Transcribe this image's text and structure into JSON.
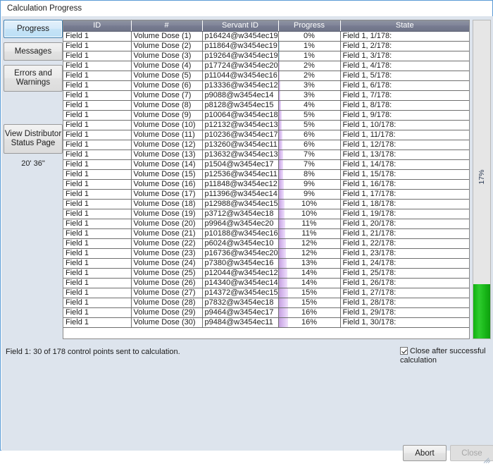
{
  "window": {
    "title": "Calculation Progress"
  },
  "nav": {
    "buttons": [
      {
        "id": "progress",
        "label": "Progress",
        "selected": true
      },
      {
        "id": "messages",
        "label": "Messages",
        "selected": false
      },
      {
        "id": "errors",
        "label": "Errors and Warnings",
        "selected": false
      },
      {
        "id": "view-distributor",
        "label": "View Distributor Status Page",
        "selected": false
      }
    ],
    "elapsed_time": "20' 36\""
  },
  "grid": {
    "columns": [
      "ID",
      "#",
      "Servant ID",
      "Progress",
      "State"
    ],
    "rows": [
      {
        "id": "Field 1",
        "num": "Volume Dose (1)",
        "servant": "p16424@w3454ec19",
        "progress": "0%",
        "pct": 0,
        "state": "Field 1, 1/178:"
      },
      {
        "id": "Field 1",
        "num": "Volume Dose (2)",
        "servant": "p11864@w3454ec19",
        "progress": "1%",
        "pct": 1,
        "state": "Field 1, 2/178:"
      },
      {
        "id": "Field 1",
        "num": "Volume Dose (3)",
        "servant": "p19264@w3454ec19",
        "progress": "1%",
        "pct": 1,
        "state": "Field 1, 3/178:"
      },
      {
        "id": "Field 1",
        "num": "Volume Dose (4)",
        "servant": "p17724@w3454ec20",
        "progress": "2%",
        "pct": 2,
        "state": "Field 1, 4/178:"
      },
      {
        "id": "Field 1",
        "num": "Volume Dose (5)",
        "servant": "p11044@w3454ec16",
        "progress": "2%",
        "pct": 2,
        "state": "Field 1, 5/178:"
      },
      {
        "id": "Field 1",
        "num": "Volume Dose (6)",
        "servant": "p13336@w3454ec12",
        "progress": "3%",
        "pct": 3,
        "state": "Field 1, 6/178:"
      },
      {
        "id": "Field 1",
        "num": "Volume Dose (7)",
        "servant": "p9088@w3454ec14",
        "progress": "3%",
        "pct": 3,
        "state": "Field 1, 7/178:"
      },
      {
        "id": "Field 1",
        "num": "Volume Dose (8)",
        "servant": "p8128@w3454ec15",
        "progress": "4%",
        "pct": 4,
        "state": "Field 1, 8/178:"
      },
      {
        "id": "Field 1",
        "num": "Volume Dose (9)",
        "servant": "p10064@w3454ec18",
        "progress": "5%",
        "pct": 5,
        "state": "Field 1, 9/178:"
      },
      {
        "id": "Field 1",
        "num": "Volume Dose (10)",
        "servant": "p12132@w3454ec13",
        "progress": "5%",
        "pct": 5,
        "state": "Field 1, 10/178:"
      },
      {
        "id": "Field 1",
        "num": "Volume Dose (11)",
        "servant": "p10236@w3454ec17",
        "progress": "6%",
        "pct": 6,
        "state": "Field 1, 11/178:"
      },
      {
        "id": "Field 1",
        "num": "Volume Dose (12)",
        "servant": "p13260@w3454ec11",
        "progress": "6%",
        "pct": 6,
        "state": "Field 1, 12/178:"
      },
      {
        "id": "Field 1",
        "num": "Volume Dose (13)",
        "servant": "p13632@w3454ec13",
        "progress": "7%",
        "pct": 7,
        "state": "Field 1, 13/178:"
      },
      {
        "id": "Field 1",
        "num": "Volume Dose (14)",
        "servant": "p1504@w3454ec17",
        "progress": "7%",
        "pct": 7,
        "state": "Field 1, 14/178:"
      },
      {
        "id": "Field 1",
        "num": "Volume Dose (15)",
        "servant": "p12536@w3454ec11",
        "progress": "8%",
        "pct": 8,
        "state": "Field 1, 15/178:"
      },
      {
        "id": "Field 1",
        "num": "Volume Dose (16)",
        "servant": "p11848@w3454ec12",
        "progress": "9%",
        "pct": 9,
        "state": "Field 1, 16/178:"
      },
      {
        "id": "Field 1",
        "num": "Volume Dose (17)",
        "servant": "p11396@w3454ec14",
        "progress": "9%",
        "pct": 9,
        "state": "Field 1, 17/178:"
      },
      {
        "id": "Field 1",
        "num": "Volume Dose (18)",
        "servant": "p12988@w3454ec15",
        "progress": "10%",
        "pct": 10,
        "state": "Field 1, 18/178:"
      },
      {
        "id": "Field 1",
        "num": "Volume Dose (19)",
        "servant": "p3712@w3454ec18",
        "progress": "10%",
        "pct": 10,
        "state": "Field 1, 19/178:"
      },
      {
        "id": "Field 1",
        "num": "Volume Dose (20)",
        "servant": "p9964@w3454ec20",
        "progress": "11%",
        "pct": 11,
        "state": "Field 1, 20/178:"
      },
      {
        "id": "Field 1",
        "num": "Volume Dose (21)",
        "servant": "p10188@w3454ec16",
        "progress": "11%",
        "pct": 11,
        "state": "Field 1, 21/178:"
      },
      {
        "id": "Field 1",
        "num": "Volume Dose (22)",
        "servant": "p6024@w3454ec10",
        "progress": "12%",
        "pct": 12,
        "state": "Field 1, 22/178:"
      },
      {
        "id": "Field 1",
        "num": "Volume Dose (23)",
        "servant": "p16736@w3454ec20",
        "progress": "12%",
        "pct": 12,
        "state": "Field 1, 23/178:"
      },
      {
        "id": "Field 1",
        "num": "Volume Dose (24)",
        "servant": "p7380@w3454ec16",
        "progress": "13%",
        "pct": 13,
        "state": "Field 1, 24/178:"
      },
      {
        "id": "Field 1",
        "num": "Volume Dose (25)",
        "servant": "p12044@w3454ec12",
        "progress": "14%",
        "pct": 14,
        "state": "Field 1, 25/178:"
      },
      {
        "id": "Field 1",
        "num": "Volume Dose (26)",
        "servant": "p14340@w3454ec14",
        "progress": "14%",
        "pct": 14,
        "state": "Field 1, 26/178:"
      },
      {
        "id": "Field 1",
        "num": "Volume Dose (27)",
        "servant": "p14372@w3454ec15",
        "progress": "15%",
        "pct": 15,
        "state": "Field 1, 27/178:"
      },
      {
        "id": "Field 1",
        "num": "Volume Dose (28)",
        "servant": "p7832@w3454ec18",
        "progress": "15%",
        "pct": 15,
        "state": "Field 1, 28/178:"
      },
      {
        "id": "Field 1",
        "num": "Volume Dose (29)",
        "servant": "p9464@w3454ec17",
        "progress": "16%",
        "pct": 16,
        "state": "Field 1, 29/178:"
      },
      {
        "id": "Field 1",
        "num": "Volume Dose (30)",
        "servant": "p9484@w3454ec11",
        "progress": "16%",
        "pct": 16,
        "state": "Field 1, 30/178:"
      }
    ]
  },
  "overall_progress": {
    "label": "17%",
    "value": 17,
    "color": "#19b219"
  },
  "status": {
    "text": "Field 1: 30 of 178 control points sent to calculation.",
    "close_after_label": "Close after successful calculation",
    "close_after_checked": true
  },
  "footer": {
    "abort_label": "Abort",
    "close_label": "Close",
    "close_enabled": false
  }
}
